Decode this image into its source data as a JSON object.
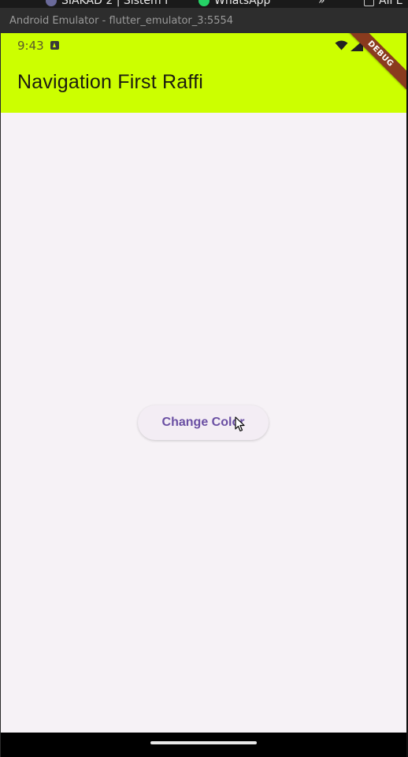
{
  "taskbar": {
    "items": [
      {
        "label": "SIAKAD 2 | Sistem I"
      },
      {
        "label": "WhatsApp"
      },
      {
        "label": "»"
      },
      {
        "label": "All E"
      }
    ]
  },
  "window": {
    "title": "Android Emulator - flutter_emulator_3:5554"
  },
  "status_bar": {
    "time": "9:43",
    "icons": [
      "notification-a-icon",
      "wifi-icon",
      "signal-icon",
      "battery-icon"
    ]
  },
  "app_bar": {
    "title": "Navigation First Raffi",
    "background_color": "#ccff00"
  },
  "debug_banner": {
    "label": "DEBUG"
  },
  "main": {
    "button_label": "Change Color",
    "button_text_color": "#6a4fa3"
  },
  "nav_bar": {
    "icons": [
      "home-handle"
    ]
  }
}
